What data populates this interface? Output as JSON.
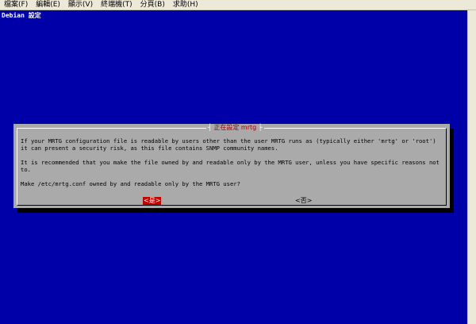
{
  "menu": {
    "items": [
      "檔案(F)",
      "編輯(E)",
      "顯示(V)",
      "終端機(T)",
      "分頁(B)",
      "求助(H)"
    ]
  },
  "terminal": {
    "title": "Debian 設定"
  },
  "dialog": {
    "title": "正在設定 mrtg",
    "paragraph1": "If your MRTG configuration file is readable by users other than the user MRTG runs as (typically either 'mrtg' or 'root') it can present a security risk, as this file contains SNMP community names.",
    "paragraph2": "It is recommended that you make the file owned by and readable only by the MRTG user, unless you have specific reasons not to.",
    "question": "Make /etc/mrtg.conf owned by and readable only by the MRTG user?",
    "yes_label": "<是>",
    "no_label": "<否>"
  },
  "colors": {
    "terminal_bg": "#0000a8",
    "dialog_bg": "#aaaaaa",
    "title_red": "#a80000",
    "yes_button_bg": "#c40000"
  }
}
